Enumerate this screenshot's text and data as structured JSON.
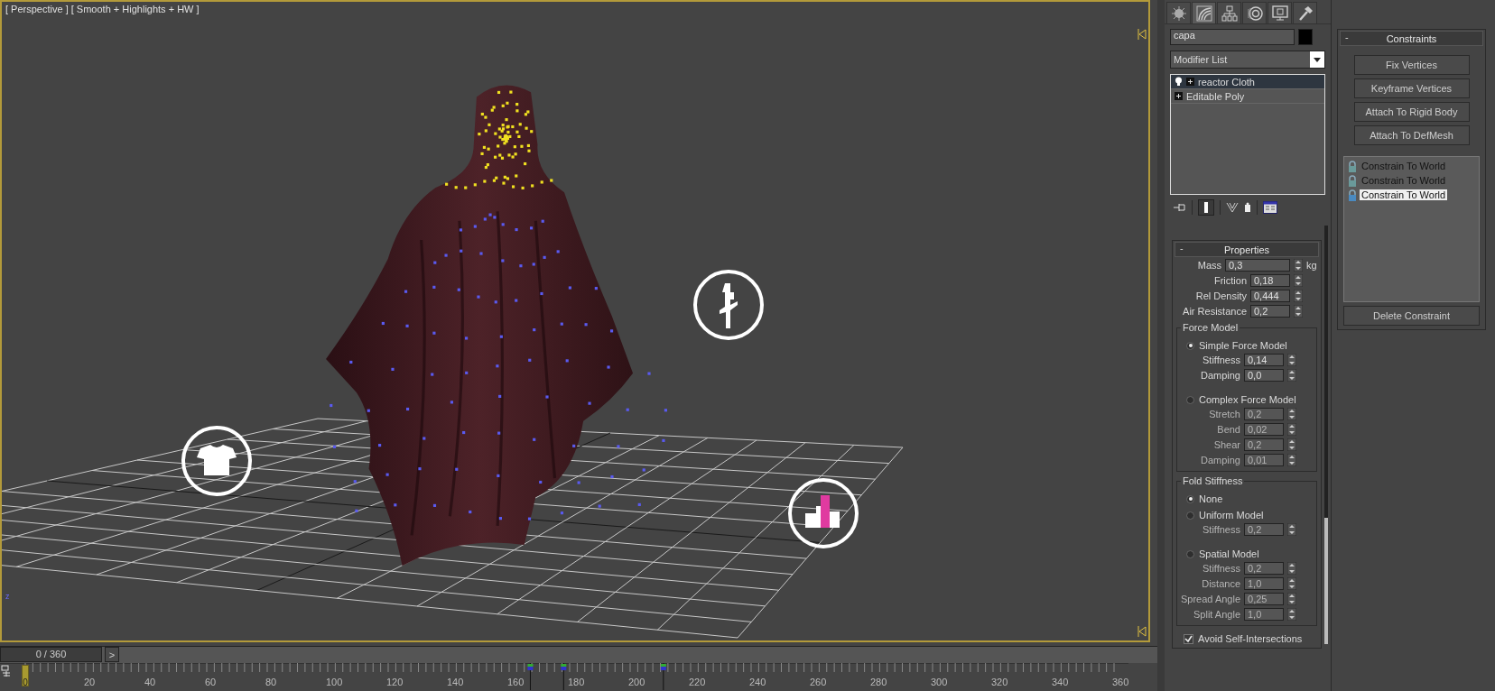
{
  "viewport": {
    "label": "[ Perspective ] [ Smooth + Highlights + HW ]",
    "active": true,
    "axis_label": "z"
  },
  "timeline": {
    "frame_counter": "0 / 360",
    "next_button": ">",
    "current_frame": "0",
    "tick_labels": [
      "20",
      "40",
      "60",
      "80",
      "100",
      "120",
      "140",
      "160",
      "180",
      "200",
      "220",
      "240",
      "260",
      "280",
      "300",
      "320",
      "340",
      "360"
    ]
  },
  "command_panel": {
    "tabs": [
      {
        "kind": "create",
        "selected": false
      },
      {
        "kind": "modify",
        "selected": true
      },
      {
        "kind": "hierarchy",
        "selected": false
      },
      {
        "kind": "motion",
        "selected": false
      },
      {
        "kind": "display",
        "selected": false
      },
      {
        "kind": "utilities",
        "selected": false
      }
    ],
    "object_name": "capa",
    "modifier_list": "Modifier List",
    "stack": [
      {
        "label": "reactor Cloth",
        "selected": true,
        "kind": "modifier"
      },
      {
        "label": "Editable Poly",
        "selected": false,
        "kind": "base"
      }
    ],
    "properties": {
      "title": "Properties",
      "collapse": "-",
      "params": [
        {
          "label": "Mass",
          "value": "0,3",
          "unit": "kg"
        },
        {
          "label": "Friction",
          "value": "0,18"
        },
        {
          "label": "Rel Density",
          "value": "0,444"
        },
        {
          "label": "Air Resistance",
          "value": "0,2"
        }
      ],
      "force_model": {
        "title": "Force Model",
        "options": [
          {
            "label": "Simple Force Model",
            "selected": true,
            "params": [
              {
                "label": "Stiffness",
                "value": "0,14"
              },
              {
                "label": "Damping",
                "value": "0,0"
              }
            ]
          },
          {
            "label": "Complex Force Model",
            "selected": false,
            "params": [
              {
                "label": "Stretch",
                "value": "0,2"
              },
              {
                "label": "Bend",
                "value": "0,02"
              },
              {
                "label": "Shear",
                "value": "0,2"
              },
              {
                "label": "Damping",
                "value": "0,01"
              }
            ]
          }
        ]
      },
      "fold_stiffness": {
        "title": "Fold Stiffness",
        "options": [
          {
            "label": "None",
            "selected": true
          },
          {
            "label": "Uniform Model",
            "selected": false,
            "params": [
              {
                "label": "Stiffness",
                "value": "0,2"
              }
            ]
          },
          {
            "label": "Spatial Model",
            "selected": false,
            "params": [
              {
                "label": "Stiffness",
                "value": "0,2"
              },
              {
                "label": "Distance",
                "value": "1,0"
              },
              {
                "label": "Spread Angle",
                "value": "0,25"
              },
              {
                "label": "Split Angle",
                "value": "1,0"
              }
            ]
          }
        ]
      },
      "avoid_self_intersections": {
        "label": "Avoid Self-Intersections",
        "checked": true
      }
    }
  },
  "constraints": {
    "title": "Constraints",
    "collapse": "-",
    "buttons": [
      "Fix Vertices",
      "Keyframe Vertices",
      "Attach To Rigid Body",
      "Attach To DefMesh"
    ],
    "items": [
      {
        "label": "Constrain To World",
        "selected": false
      },
      {
        "label": "Constrain To World",
        "selected": false
      },
      {
        "label": "Constrain To World",
        "selected": true
      }
    ],
    "delete_button": "Delete Constraint"
  }
}
